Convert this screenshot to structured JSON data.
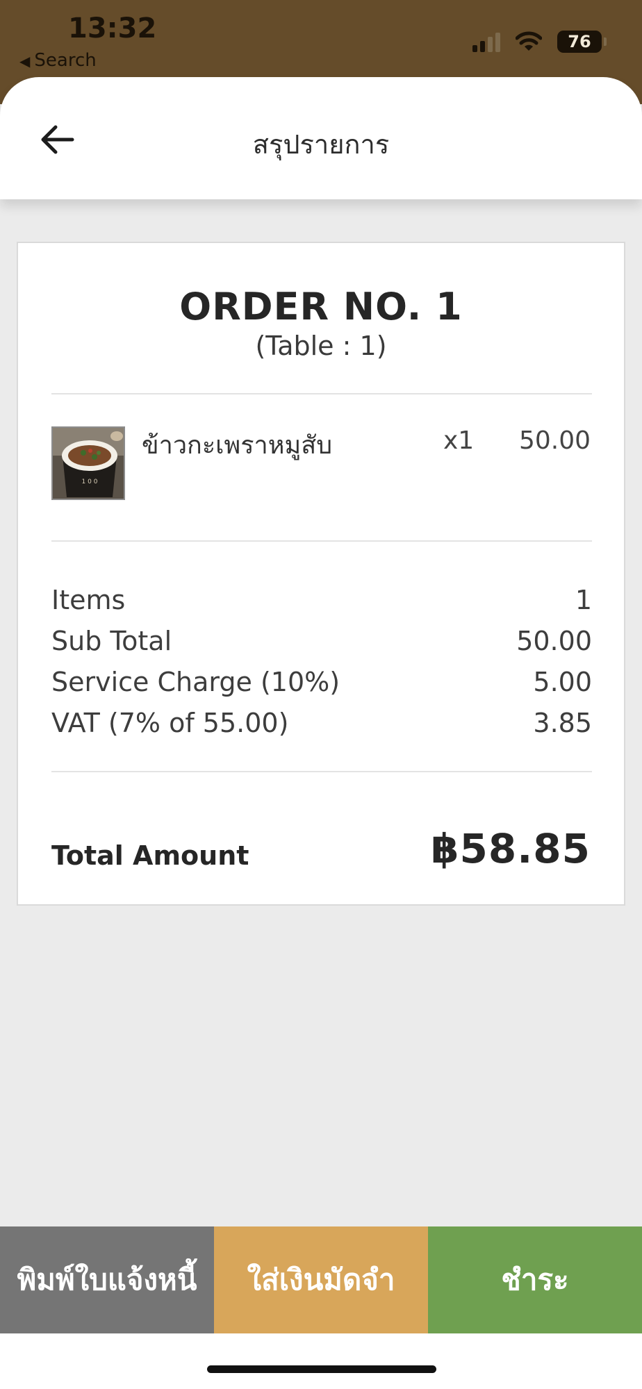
{
  "status_bar": {
    "time": "13:32",
    "back_label": "Search",
    "battery": "76",
    "signal_bars": 4,
    "signal_active": 2
  },
  "header": {
    "title": "สรุปรายการ"
  },
  "order": {
    "title": "ORDER NO. 1",
    "table": "(Table : 1)",
    "items": [
      {
        "name": "ข้าวกะเพราหมูสับ",
        "qty": "x1",
        "price": "50.00",
        "image_icon": "food-bowl-image"
      }
    ],
    "summary": {
      "items_label": "Items",
      "items_value": "1",
      "subtotal_label": "Sub Total",
      "subtotal_value": "50.00",
      "service_label": "Service Charge (10%)",
      "service_value": "5.00",
      "vat_label": "VAT (7% of 55.00)",
      "vat_value": "3.85"
    },
    "total_label": "Total Amount",
    "total_value": "฿58.85"
  },
  "actions": {
    "print_label": "พิมพ์ใบแจ้งหนี้",
    "deposit_label": "ใส่เงินมัดจำ",
    "pay_label": "ชำระ"
  },
  "colors": {
    "status_bg": "#654c2a",
    "print_bg": "#757575",
    "deposit_bg": "#d8a65a",
    "pay_bg": "#6fa050"
  }
}
